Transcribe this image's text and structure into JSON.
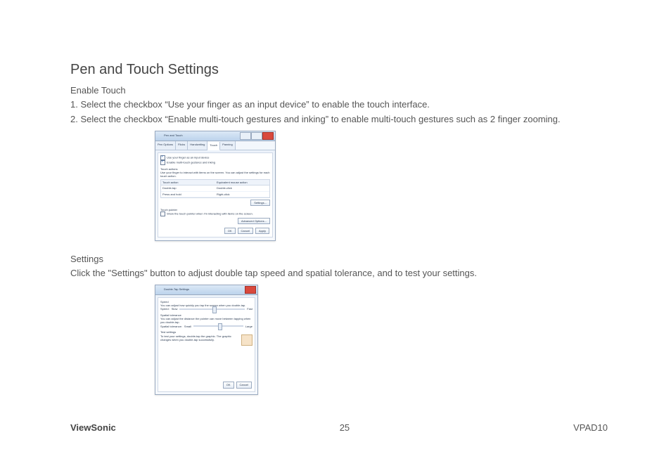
{
  "heading": "Pen and Touch Settings",
  "section1": {
    "subhead": "Enable Touch",
    "step1": "1. Select the checkbox “Use your finger as an input device” to enable the touch interface.",
    "step2": "2. Select the checkbox “Enable multi-touch gestures and inking” to enable multi-touch gestures such as 2 finger zooming."
  },
  "fig1": {
    "window_title": "Pen and Touch",
    "tabs": [
      "Pen Options",
      "Flicks",
      "Handwriting",
      "Touch",
      "Panning"
    ],
    "cb1": "Use your finger as an input device",
    "cb2": "Enable multi-touch gestures and inking",
    "touch_actions_label": "Touch actions",
    "touch_actions_desc": "Use your finger to interact with items on the screen. You can adjust the settings for each touch action.",
    "col1": "Touch action",
    "col2": "Equivalent mouse action",
    "r1c1": "Double-tap",
    "r1c2": "Double-click",
    "r2c1": "Press and hold",
    "r2c2": "Right-click",
    "settings_btn": "Settings...",
    "pointer_label": "Touch pointer",
    "pointer_desc": "Show the touch pointer when I'm interacting with items on the screen.",
    "adv_btn": "Advanced Options...",
    "ok": "OK",
    "cancel": "Cancel",
    "apply": "Apply"
  },
  "section2": {
    "subhead": "Settings",
    "body": "Click the \"Settings\" button to adjust double tap speed and spatial tolerance, and to test your settings."
  },
  "fig2": {
    "window_title": "Double-Tap Settings",
    "speed_label": "Speed",
    "speed_desc": "You can adjust how quickly you tap the screen when you double-tap.",
    "speed_row": "Speed:",
    "slow": "Slow",
    "fast": "Fast",
    "spatial_label": "Spatial tolerance",
    "spatial_desc": "You can adjust the distance the pointer can move between tapping when you double-tap.",
    "spatial_row": "Spatial tolerance:",
    "small": "Small",
    "large": "Large",
    "test_label": "Test settings",
    "test_desc": "To test your settings, double-tap the graphic. The graphic changes when you double-tap successfully.",
    "ok": "OK",
    "cancel": "Cancel"
  },
  "footer": {
    "brand": "ViewSonic",
    "page": "25",
    "model": "VPAD10"
  }
}
